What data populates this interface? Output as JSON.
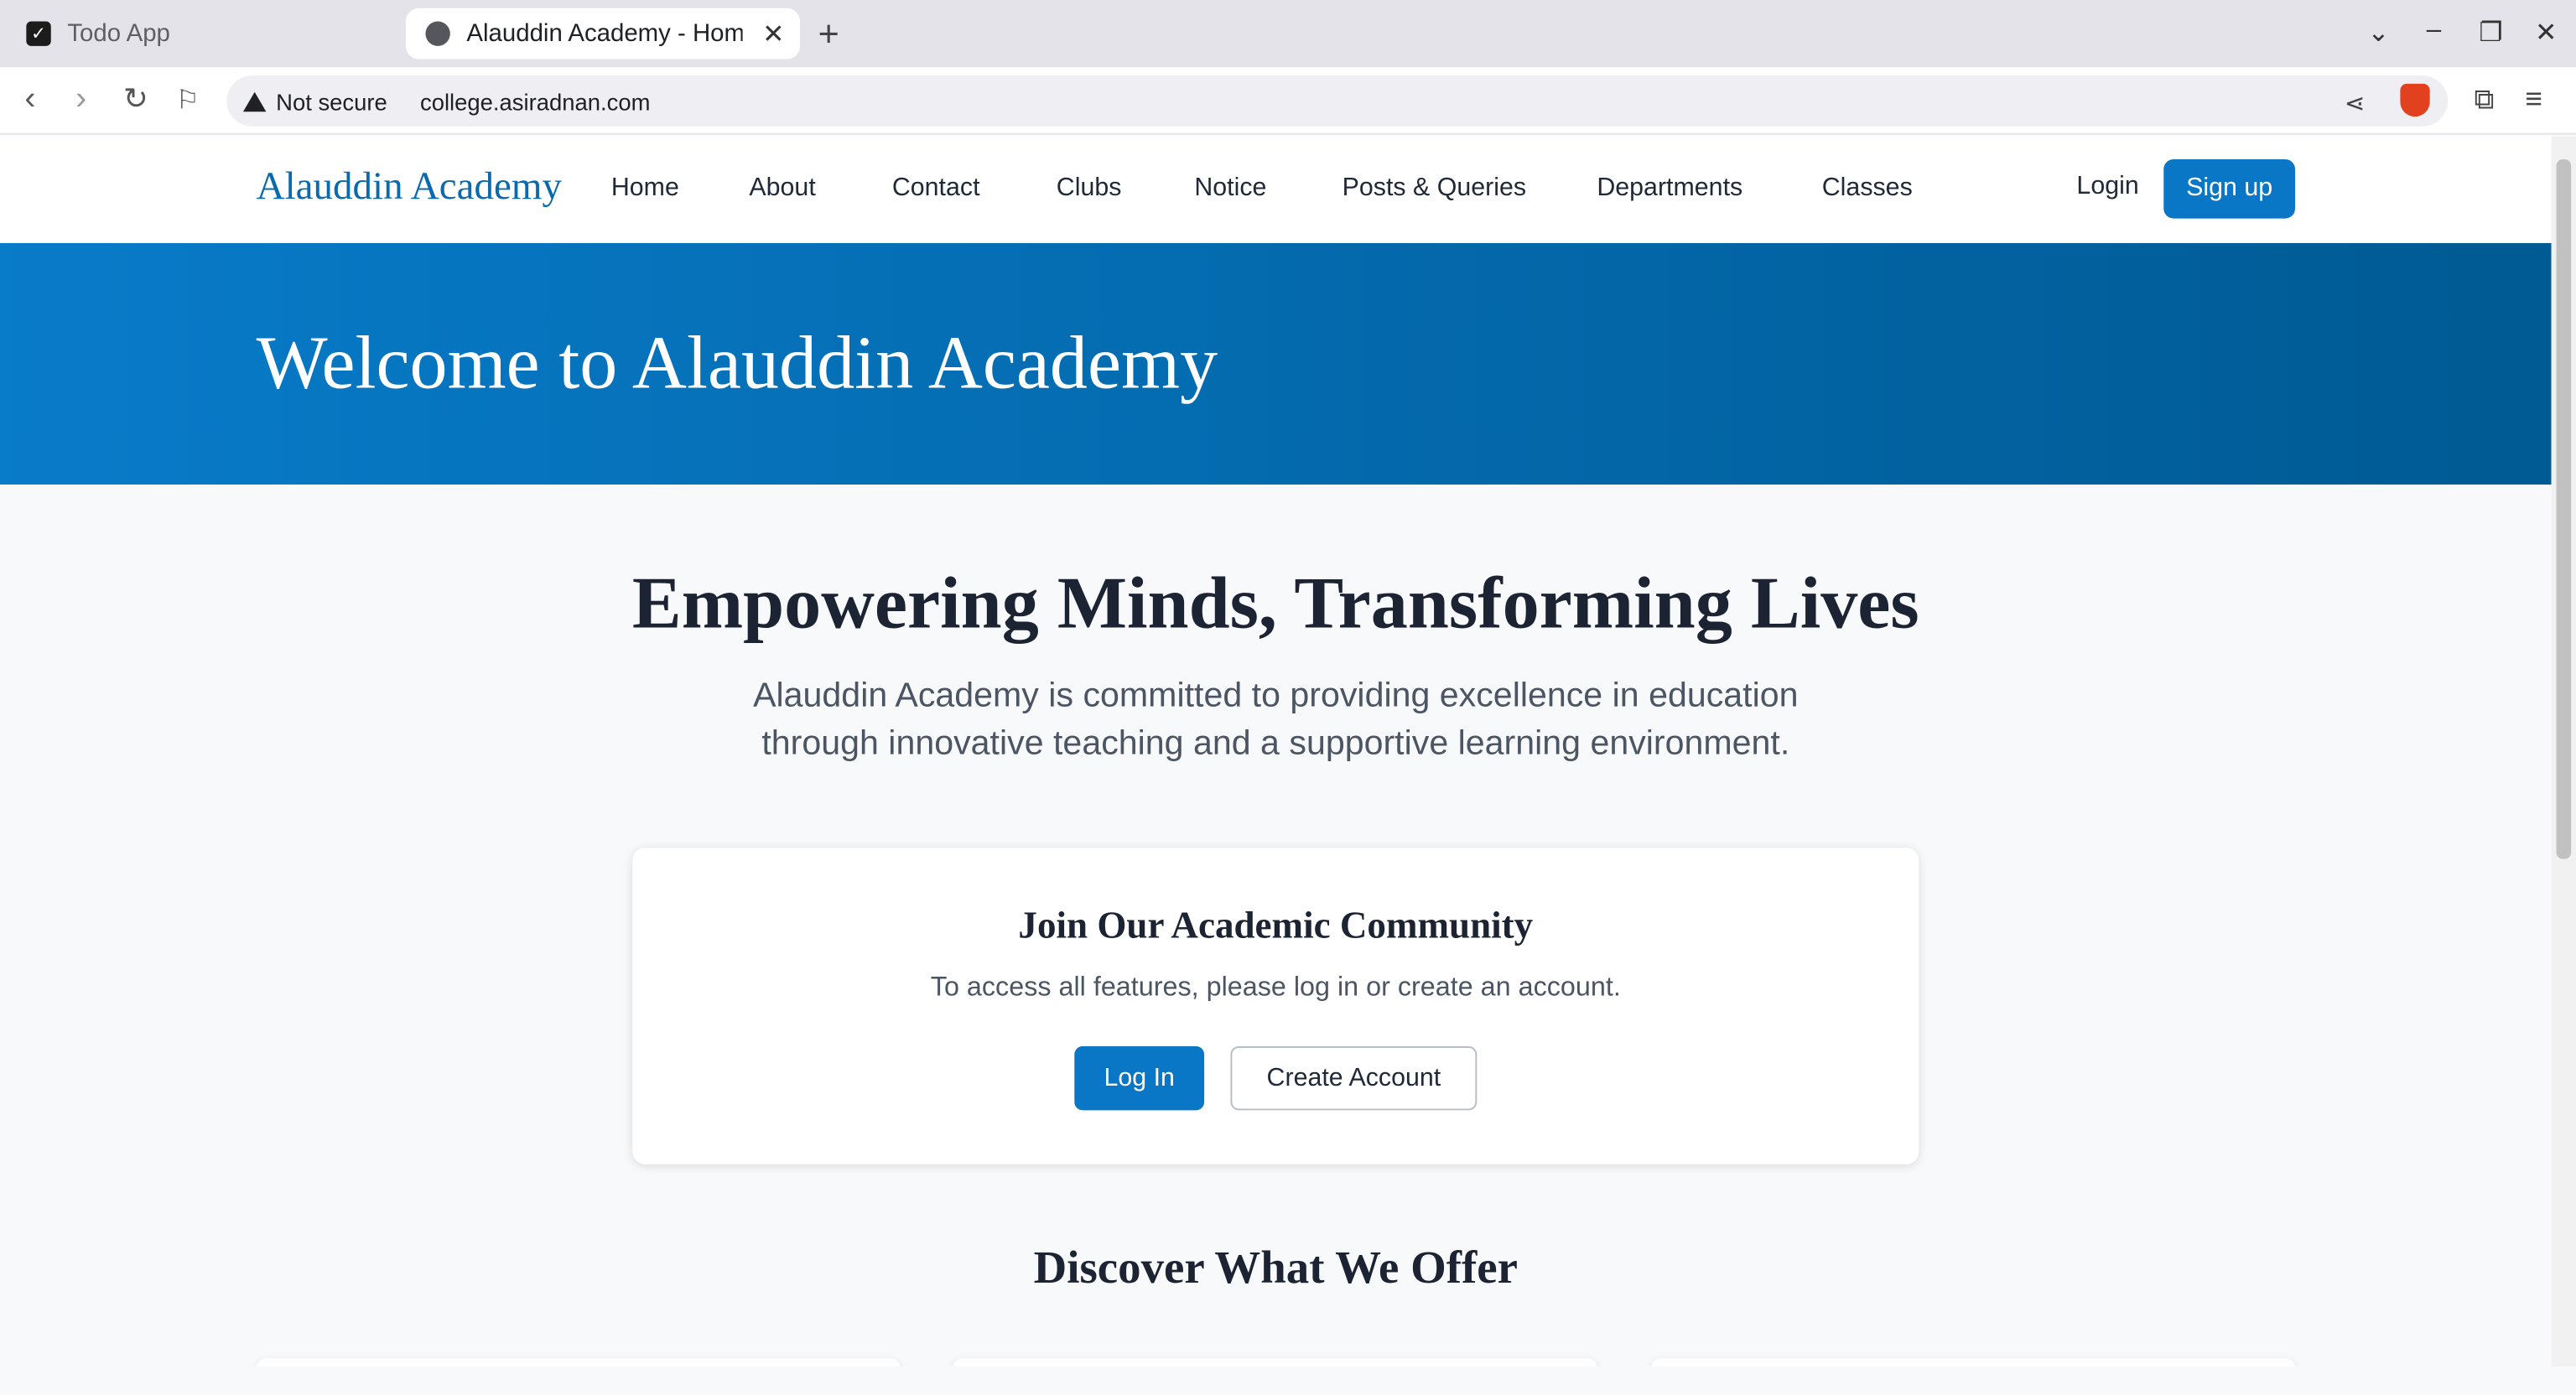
{
  "browser": {
    "tabs": [
      {
        "title": "Todo App",
        "active": false
      },
      {
        "title": "Alauddin Academy - Home",
        "active": true
      }
    ],
    "new_tab_label": "+",
    "security_label": "Not secure",
    "url": "college.asiradnan.com"
  },
  "site": {
    "logo": "Alauddin Academy",
    "nav": [
      "Home",
      "About",
      "Contact",
      "Clubs",
      "Notice",
      "Posts & Queries",
      "Departments",
      "Classes"
    ],
    "login_label": "Login",
    "signup_label": "Sign up"
  },
  "hero": {
    "title": "Welcome to Alauddin Academy"
  },
  "intro": {
    "heading": "Empowering Minds, Transforming Lives",
    "line1": "Alauddin Academy is committed to providing excellence in education",
    "line2": "through innovative teaching and a supportive learning environment."
  },
  "join_card": {
    "title": "Join Our Academic Community",
    "subtitle": "To access all features, please log in or create an account.",
    "login_button": "Log In",
    "create_button": "Create Account"
  },
  "offers": {
    "heading": "Discover What We Offer"
  },
  "colors": {
    "primary": "#0a76c6",
    "hero_start": "#087bc9",
    "hero_end": "#005a93",
    "heading": "#1c2333"
  }
}
